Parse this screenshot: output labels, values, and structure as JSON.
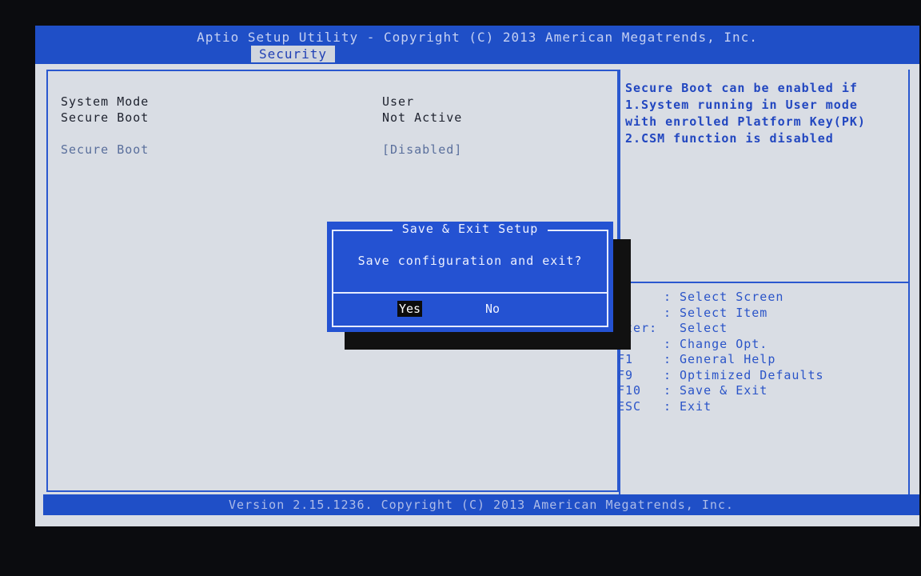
{
  "header": {
    "title": "Aptio Setup Utility - Copyright (C) 2013 American Megatrends, Inc.",
    "active_tab": "Security"
  },
  "settings": {
    "system_mode_label": "System Mode",
    "system_mode_value": "User",
    "secure_boot_status_label": "Secure Boot",
    "secure_boot_status_value": "Not Active",
    "secure_boot_option_label": "Secure Boot",
    "secure_boot_option_value": "[Disabled]"
  },
  "help": {
    "lines": [
      "Secure Boot can be enabled if",
      "1.System running in User mode",
      "with enrolled Platform Key(PK)",
      "2.CSM function is disabled"
    ]
  },
  "keys": [
    {
      "key": "←",
      "sep": ":",
      "action": "Select Screen"
    },
    {
      "key": "↓",
      "sep": ":",
      "action": "Select Item"
    },
    {
      "key": "nter:",
      "sep": "",
      "action": "Select"
    },
    {
      "key": "/-",
      "sep": ":",
      "action": "Change Opt."
    },
    {
      "key": "F1",
      "sep": ":",
      "action": "General Help"
    },
    {
      "key": "F9",
      "sep": ":",
      "action": "Optimized Defaults"
    },
    {
      "key": "F10",
      "sep": ":",
      "action": "Save & Exit"
    },
    {
      "key": "ESC",
      "sep": ":",
      "action": "Exit"
    }
  ],
  "dialog": {
    "title": "Save & Exit Setup",
    "message": "Save configuration and exit?",
    "yes_label": "Yes",
    "no_label": "No"
  },
  "footer": {
    "text": "Version 2.15.1236. Copyright (C) 2013 American Megatrends, Inc."
  },
  "colors": {
    "bar_blue": "#1f4fc7",
    "background": "#d9dde4",
    "help_text": "#2247c0"
  }
}
